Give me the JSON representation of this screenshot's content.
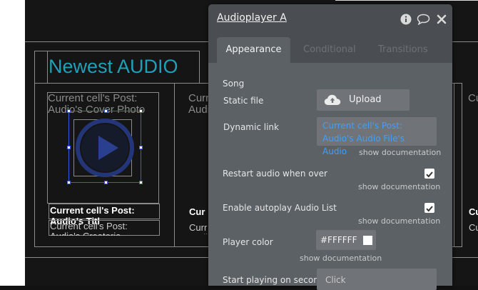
{
  "canvas": {
    "page_title": "Newest AUDIO",
    "cells": [
      {
        "photo_label": "Current cell's Post: Audio's Cover Photo",
        "title_label": "Current cell's Post: Audio's Titl",
        "creator_label": "Current cell's Post: Audio's Creatoria"
      },
      {
        "photo_label": "Curr Audi",
        "title_label": "Cur Aud",
        "creator_label": "Curr Audi"
      },
      {
        "photo_label": "Cu",
        "title_label": "Cu",
        "creator_label": "Cu"
      }
    ]
  },
  "inspector": {
    "title": "Audioplayer A",
    "icons": [
      "info-icon",
      "comment-icon",
      "close-icon"
    ],
    "tabs": {
      "appearance": "Appearance",
      "conditional": "Conditional",
      "transitions": "Transitions"
    },
    "song_label": "Song",
    "static_file_label": "Static file",
    "upload_label": "Upload",
    "dynamic_link_label": "Dynamic link",
    "dynamic_link_value": "Current cell's Post: Audio's Audio File's Audio",
    "show_documentation": "show documentation",
    "restart_label": "Restart audio when over",
    "restart_checked": true,
    "autoplay_label": "Enable autoplay Audio List",
    "autoplay_checked": true,
    "player_color_label": "Player color",
    "player_color_value": "#FFFFFF",
    "start_playing_label": "Start playing on secon",
    "start_playing_placeholder": "Click"
  },
  "colors": {
    "accent_title": "#1fa0b8",
    "link": "#3da0ff",
    "panel_bg": "#4a4e52",
    "field_bg": "#707479",
    "selection": "#3a5bd9"
  }
}
